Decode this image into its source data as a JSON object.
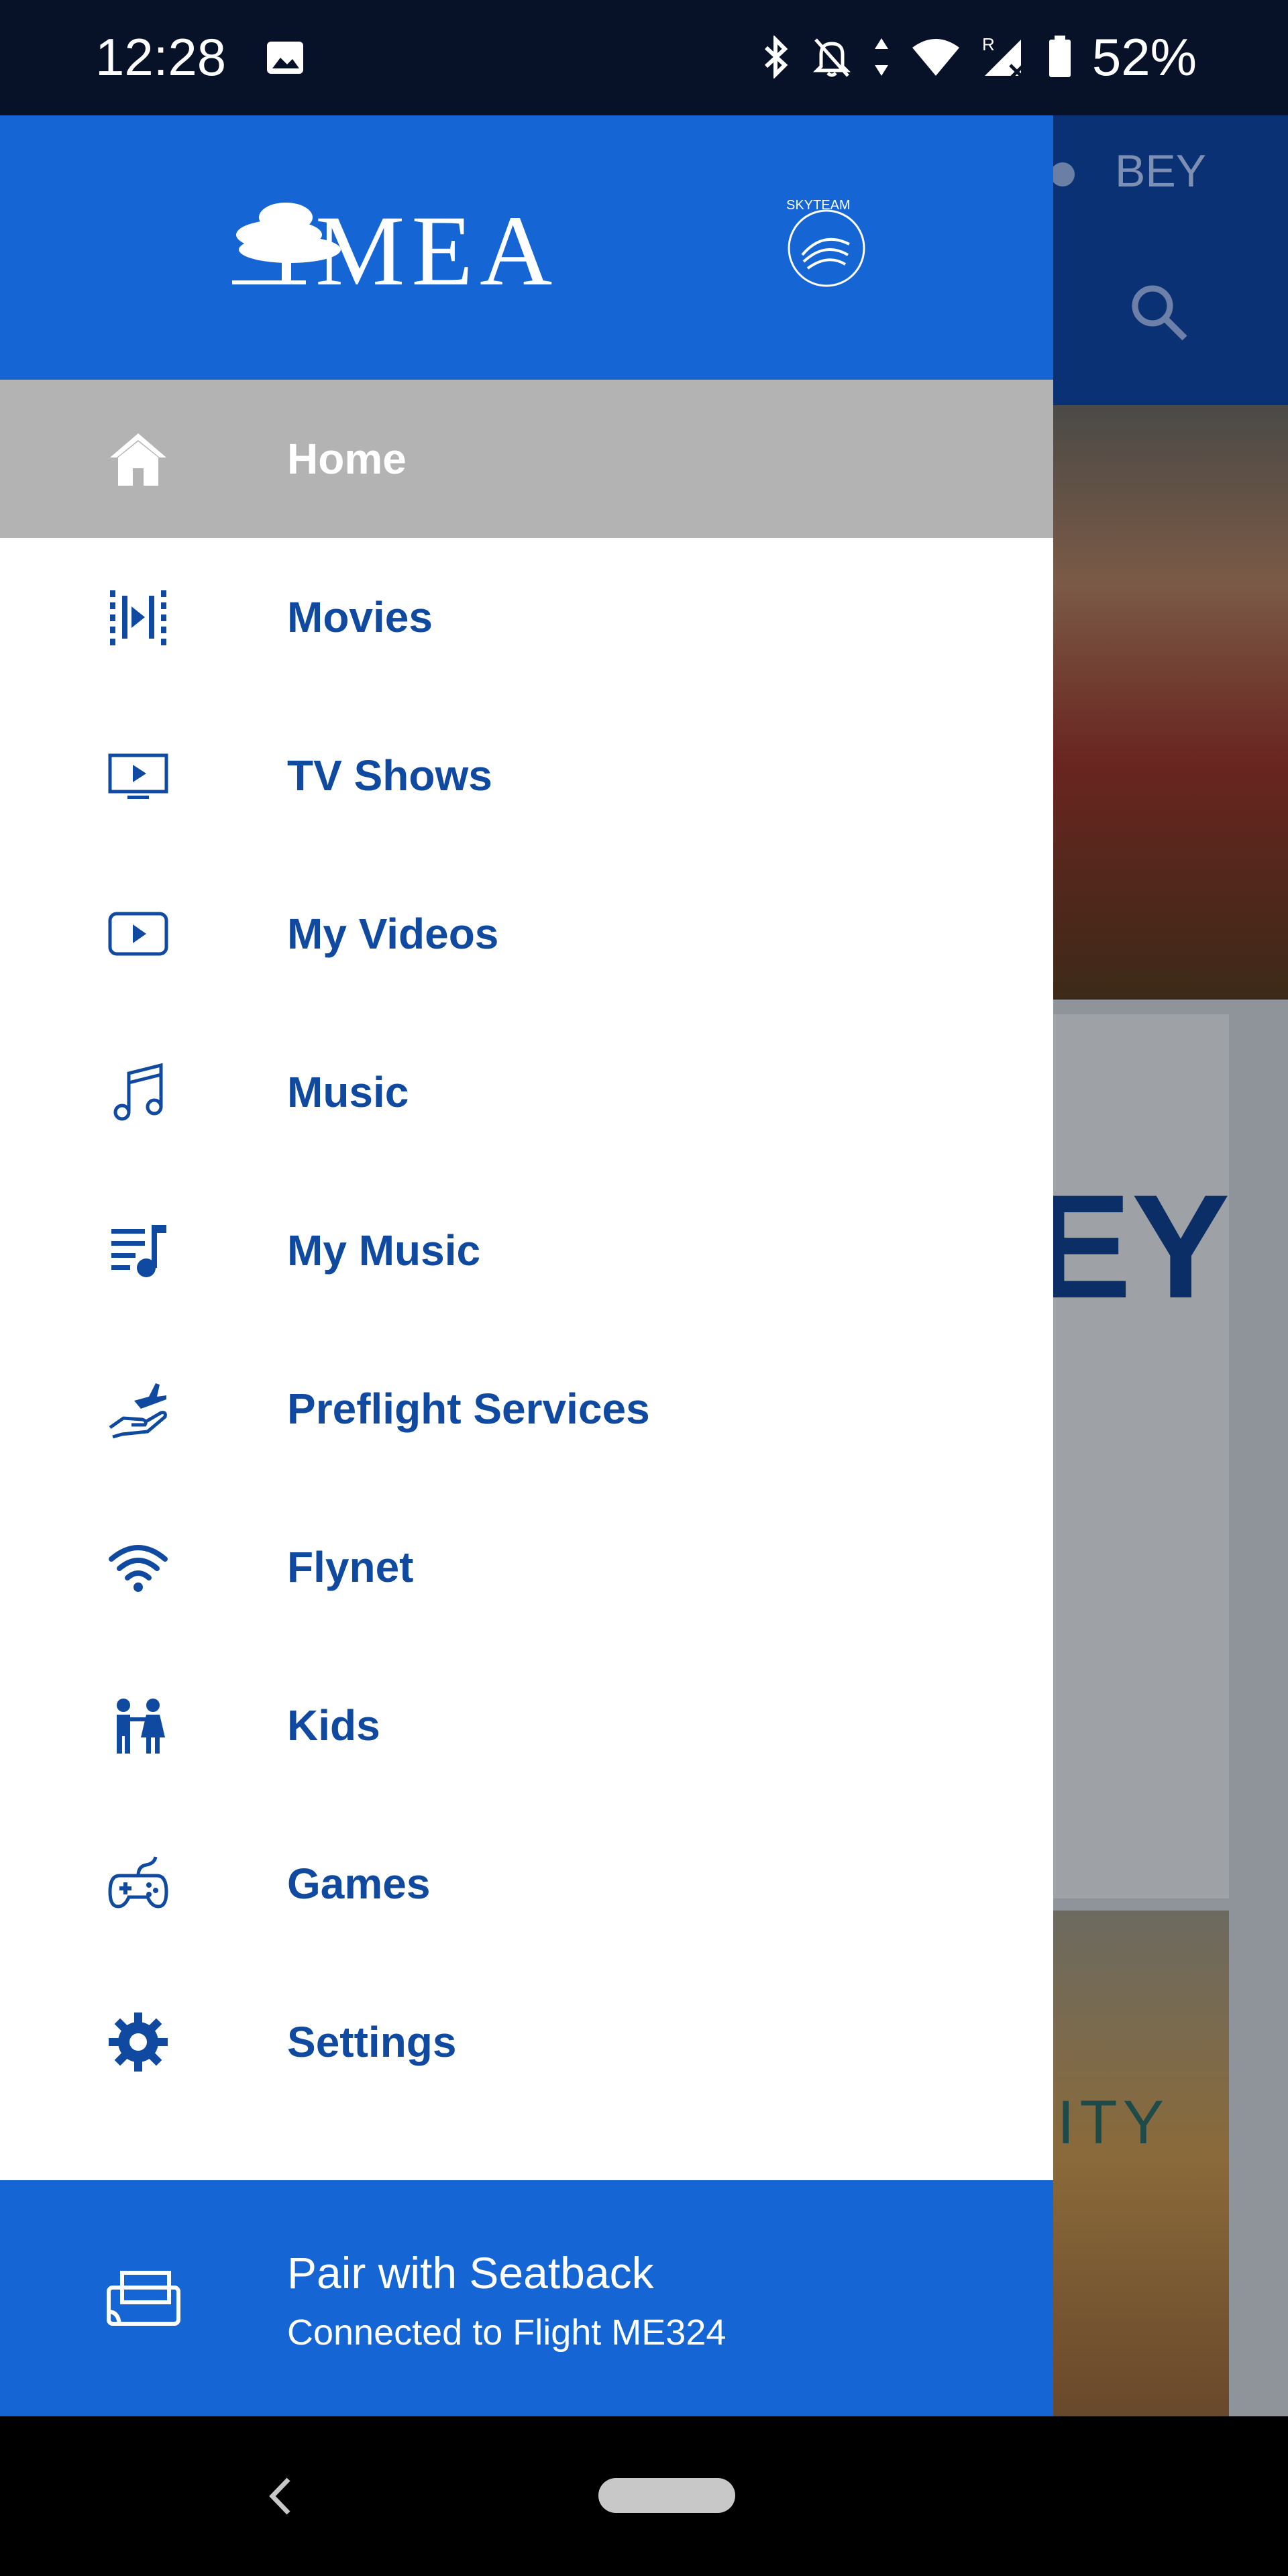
{
  "status_bar": {
    "time": "12:28",
    "battery": "52%",
    "icons": [
      "image-icon",
      "bluetooth-icon",
      "notifications-off-icon",
      "data-arrows-icon",
      "wifi-icon",
      "cell-signal-roaming-icon",
      "battery-icon"
    ]
  },
  "background_app": {
    "airport_code": "BEY",
    "card_text_1": "EY",
    "card_text_2": "ITY"
  },
  "drawer": {
    "brand": {
      "logo_text": "MEA",
      "alliance": "SKYTEAM"
    },
    "items": [
      {
        "label": "Home",
        "icon": "home-icon"
      },
      {
        "label": "Movies",
        "icon": "movies-icon"
      },
      {
        "label": "TV Shows",
        "icon": "tv-icon"
      },
      {
        "label": "My Videos",
        "icon": "video-icon"
      },
      {
        "label": "Music",
        "icon": "music-note-icon"
      },
      {
        "label": "My Music",
        "icon": "playlist-icon"
      },
      {
        "label": "Preflight Services",
        "icon": "preflight-services-icon"
      },
      {
        "label": "Flynet",
        "icon": "wifi-icon"
      },
      {
        "label": "Kids",
        "icon": "kids-icon"
      },
      {
        "label": "Games",
        "icon": "gamepad-icon"
      },
      {
        "label": "Settings",
        "icon": "gear-icon"
      }
    ],
    "pair": {
      "title": "Pair with Seatback",
      "subtitle": "Connected to Flight ME324"
    }
  },
  "colors": {
    "brand_blue": "#1565d4",
    "menu_text": "#0f4aa0",
    "active_bg": "#b3b3b3"
  }
}
